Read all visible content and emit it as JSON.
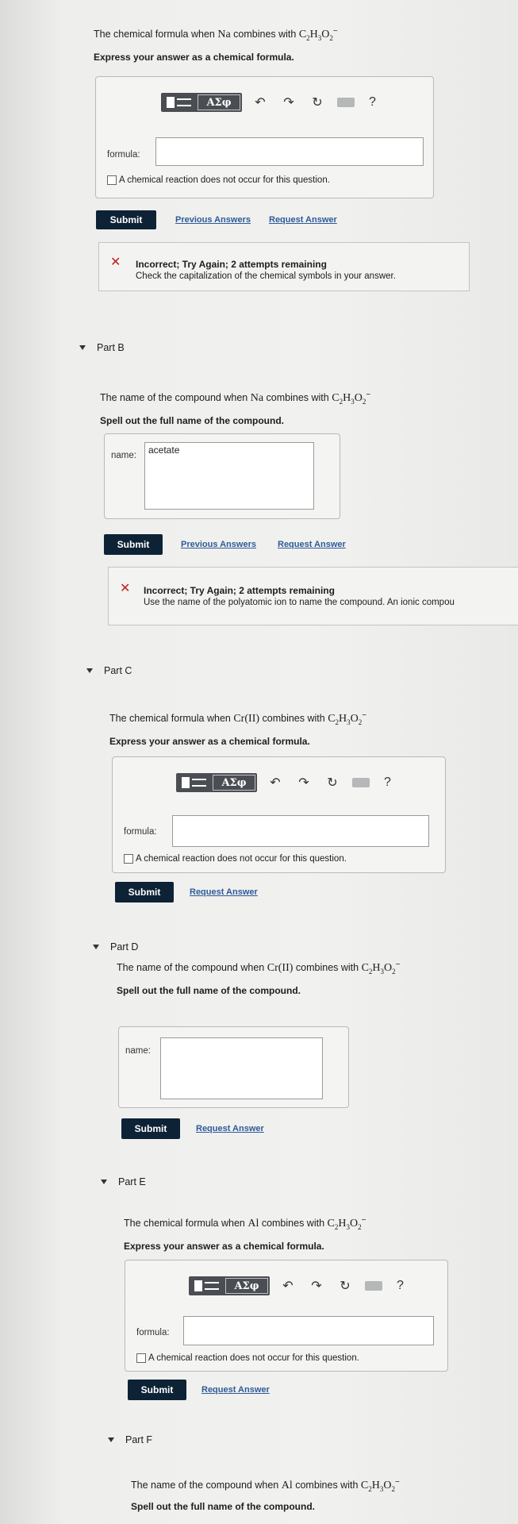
{
  "partA": {
    "q_pre": "The chemical formula when ",
    "metal": "Na",
    "q_mid": " combines with ",
    "anion": "C2H3O2",
    "charge": "−",
    "instruction": "Express your answer as a chemical formula.",
    "toolbar_greek": "ΑΣφ",
    "field_label": "formula:",
    "field_value": "",
    "no_reaction": "A chemical reaction does not occur for this question.",
    "submit": "Submit",
    "previous_answers": "Previous Answers",
    "request_answer": "Request Answer",
    "feedback_title": "Incorrect; Try Again; 2 attempts remaining",
    "feedback_msg": "Check the capitalization of the chemical symbols in your answer."
  },
  "partB": {
    "head": "Part B",
    "q_pre": "The name of the compound when ",
    "metal": "Na",
    "q_mid": " combines with ",
    "anion": "C2H3O2",
    "charge": "−",
    "instruction": "Spell out the full name of the compound.",
    "field_label": "name:",
    "field_value": "acetate",
    "submit": "Submit",
    "previous_answers": "Previous Answers",
    "request_answer": "Request Answer",
    "feedback_title": "Incorrect; Try Again; 2 attempts remaining",
    "feedback_msg": "Use the name of the polyatomic ion to name the compound. An ionic compou"
  },
  "partC": {
    "head": "Part C",
    "q_pre": "The chemical formula when ",
    "metal": "Cr(II)",
    "q_mid": " combines with ",
    "anion": "C2H3O2",
    "charge": "−",
    "instruction": "Express your answer as a chemical formula.",
    "toolbar_greek": "ΑΣφ",
    "field_label": "formula:",
    "field_value": "",
    "no_reaction": "A chemical reaction does not occur for this question.",
    "submit": "Submit",
    "request_answer": "Request Answer"
  },
  "partD": {
    "head": "Part D",
    "q_pre": "The name of the compound when ",
    "metal": "Cr(II)",
    "q_mid": " combines with ",
    "anion": "C2H3O2",
    "charge": "−",
    "instruction": "Spell out the full name of the compound.",
    "field_label": "name:",
    "field_value": "",
    "submit": "Submit",
    "request_answer": "Request Answer"
  },
  "partE": {
    "head": "Part E",
    "q_pre": "The chemical formula when ",
    "metal": "Al",
    "q_mid": " combines with ",
    "anion": "C2H3O2",
    "charge": "−",
    "instruction": "Express your answer as a chemical formula.",
    "toolbar_greek": "ΑΣφ",
    "field_label": "formula:",
    "field_value": "",
    "no_reaction": "A chemical reaction does not occur for this question.",
    "submit": "Submit",
    "request_answer": "Request Answer"
  },
  "partF": {
    "head": "Part F",
    "q_pre": "The name of the compound when ",
    "metal": "Al",
    "q_mid": " combines with ",
    "anion": "C2H3O2",
    "charge": "−",
    "instruction": "Spell out the full name of the compound."
  },
  "icons": {
    "undo": "↶",
    "redo": "↷",
    "reset": "↻",
    "help": "?",
    "incorrect": "✕"
  }
}
